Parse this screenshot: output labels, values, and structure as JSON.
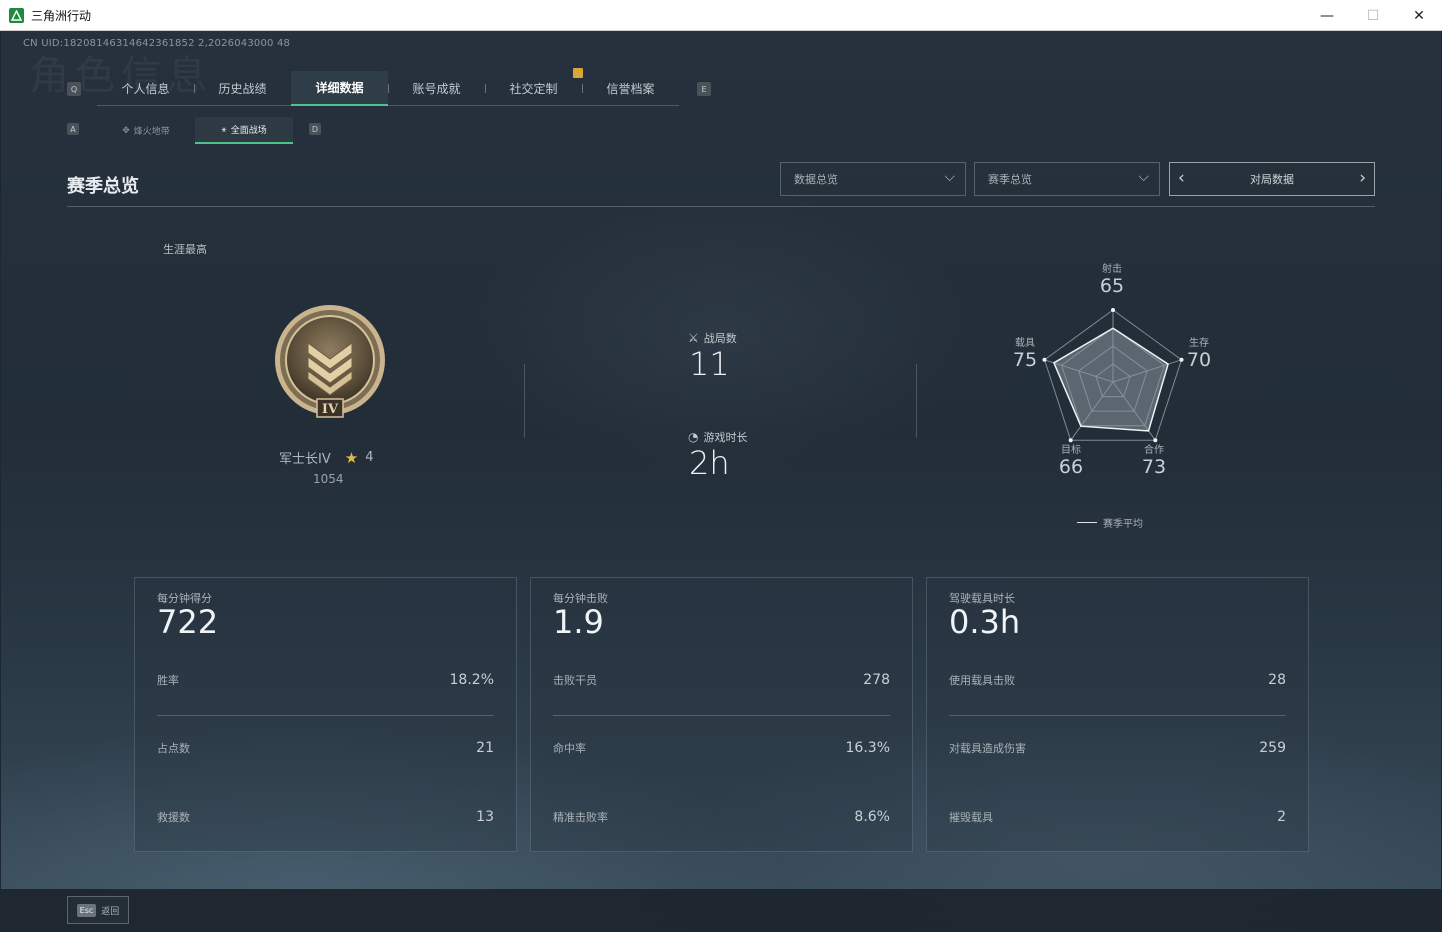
{
  "window": {
    "title": "三角洲行动",
    "minimize": "—",
    "maximize": "☐",
    "close": "✕"
  },
  "header": {
    "uid": "CN UID:18208146314642361852 2,2026043000 48",
    "watermark": "角色信息"
  },
  "tabs": {
    "left_key": "Q",
    "right_key": "E",
    "items": [
      {
        "label": "个人信息"
      },
      {
        "label": "历史战绩"
      },
      {
        "label": "详细数据"
      },
      {
        "label": "账号成就"
      },
      {
        "label": "社交定制"
      },
      {
        "label": "信誉档案"
      }
    ],
    "active_index": 2
  },
  "subtabs": {
    "left_key": "A",
    "right_key": "D",
    "items": [
      {
        "label": "烽火地带",
        "icon": "crosshair-icon"
      },
      {
        "label": "全面战场",
        "icon": "arrows-icon"
      }
    ],
    "active_index": 1
  },
  "section": {
    "title": "赛季总览",
    "dropdown1": "数据总览",
    "dropdown2": "赛季总览",
    "pager_label": "对局数据"
  },
  "rank": {
    "career_label": "生涯最高",
    "name": "军士长IV",
    "stars": "4",
    "score": "1054",
    "medal_numeral": "IV"
  },
  "middle": {
    "matches_label": "战局数",
    "matches_value": "11",
    "playtime_label": "游戏时长",
    "playtime_value": "2h"
  },
  "radar": {
    "axes": [
      {
        "name": "射击",
        "value": "65"
      },
      {
        "name": "生存",
        "value": "70"
      },
      {
        "name": "合作",
        "value": "73"
      },
      {
        "name": "目标",
        "value": "66"
      },
      {
        "name": "载具",
        "value": "75"
      }
    ],
    "legend": "赛季平均"
  },
  "cards": [
    {
      "title": "每分钟得分",
      "value": "722",
      "rows": [
        {
          "name": "胜率",
          "value": "18.2%"
        },
        {
          "name": "占点数",
          "value": "21"
        },
        {
          "name": "救援数",
          "value": "13"
        }
      ]
    },
    {
      "title": "每分钟击败",
      "value": "1.9",
      "rows": [
        {
          "name": "击败干员",
          "value": "278"
        },
        {
          "name": "命中率",
          "value": "16.3%"
        },
        {
          "name": "精准击败率",
          "value": "8.6%"
        }
      ]
    },
    {
      "title": "驾驶载具时长",
      "value": "0.3h",
      "rows": [
        {
          "name": "使用载具击败",
          "value": "28"
        },
        {
          "name": "对载具造成伤害",
          "value": "259"
        },
        {
          "name": "摧毁载具",
          "value": "2"
        }
      ]
    }
  ],
  "footer": {
    "esc_key": "Esc",
    "back_label": "返回"
  }
}
